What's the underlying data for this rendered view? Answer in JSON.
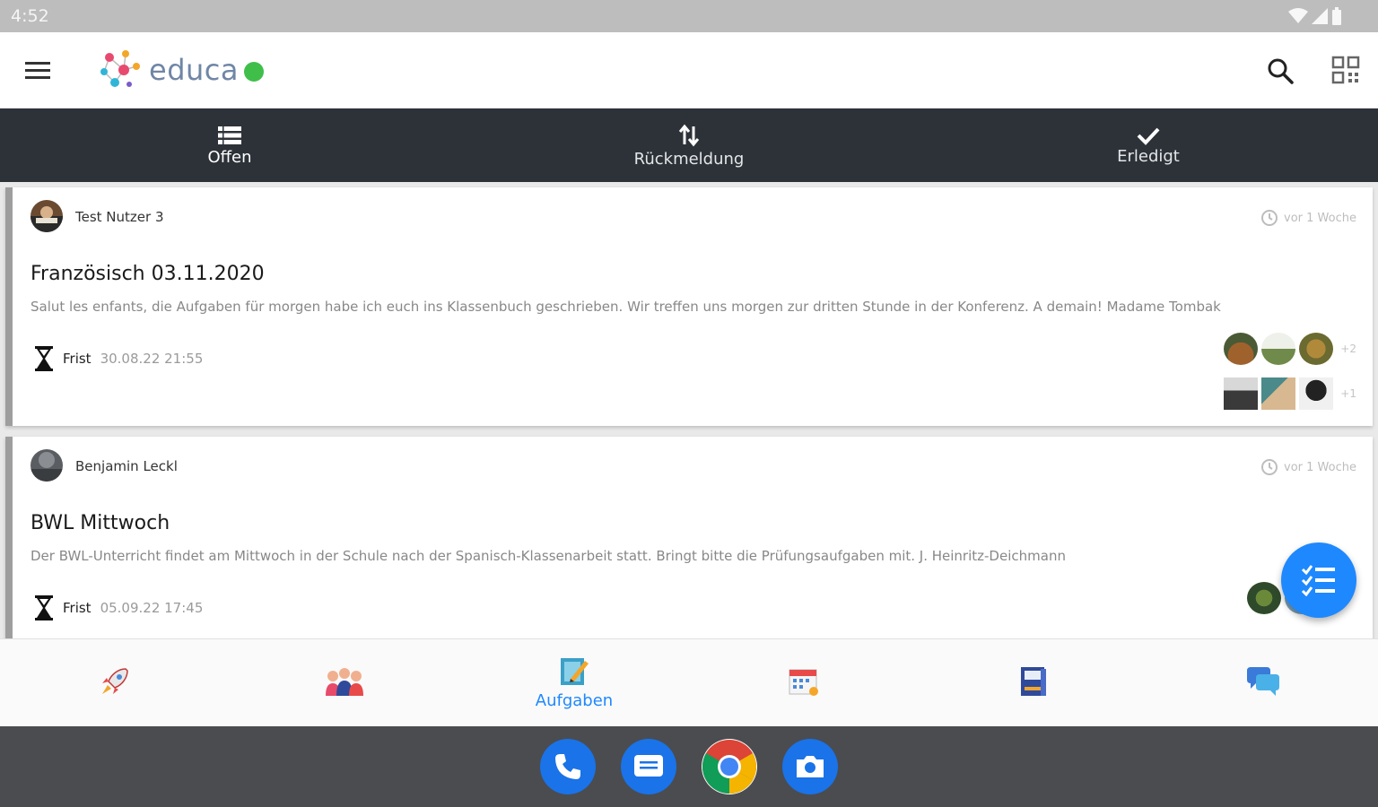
{
  "status_bar": {
    "time": "4:52"
  },
  "app": {
    "logo_text": "educa"
  },
  "tabs": [
    {
      "label": "Offen",
      "icon": "list-icon",
      "active": true
    },
    {
      "label": "Rückmeldung",
      "icon": "sort-arrows-icon",
      "active": false
    },
    {
      "label": "Erledigt",
      "icon": "check-icon",
      "active": false
    }
  ],
  "tasks": [
    {
      "author": "Test Nutzer 3",
      "time_ago": "vor 1 Woche",
      "title": "Französisch 03.11.2020",
      "text": "Salut les enfants, die Aufgaben für morgen habe ich euch ins Klassenbuch geschrieben. Wir treffen uns morgen zur dritten Stunde in der Konferenz. A demain! Madame Tombak",
      "deadline_label": "Frist",
      "deadline_value": "30.08.22 21:55",
      "row1_extra": "+2",
      "row2_extra": "+1"
    },
    {
      "author": "Benjamin Leckl",
      "time_ago": "vor 1 Woche",
      "title": "BWL Mittwoch",
      "text": "Der BWL-Unterricht findet am Mittwoch in der Schule nach der Spanisch-Klassenarbeit statt. Bringt bitte die Prüfungsaufgaben mit. J. Heinritz-Deichmann",
      "deadline_label": "Frist",
      "deadline_value": "05.09.22 17:45"
    }
  ],
  "bottom_nav": [
    {
      "icon": "rocket-icon",
      "label": ""
    },
    {
      "icon": "group-icon",
      "label": ""
    },
    {
      "icon": "tasks-icon",
      "label": "Aufgaben",
      "active": true
    },
    {
      "icon": "calendar-icon",
      "label": ""
    },
    {
      "icon": "notebook-icon",
      "label": ""
    },
    {
      "icon": "chat-icon",
      "label": ""
    }
  ],
  "colors": {
    "accent": "#1e88ff",
    "tab_bar": "#2c3238",
    "logo_dot": "#3fbf4a"
  }
}
